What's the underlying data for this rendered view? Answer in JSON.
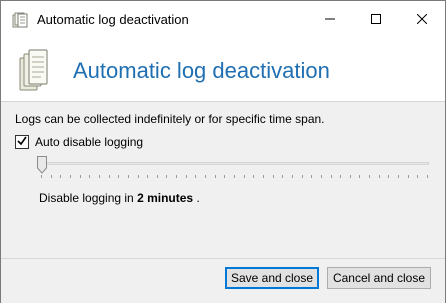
{
  "window": {
    "title": "Automatic log deactivation",
    "icon": "log-files-icon",
    "controls": {
      "minimize": "minimize-icon",
      "maximize": "maximize-icon",
      "close": "close-icon"
    }
  },
  "header": {
    "title": "Automatic log deactivation",
    "icon": "log-files-icon"
  },
  "main": {
    "description": "Logs can be collected indefinitely or for specific time span.",
    "auto_disable": {
      "label": "Auto disable logging",
      "checked": true
    },
    "slider": {
      "value_fraction": 0.0
    },
    "status": {
      "prefix": "Disable logging in",
      "value": "2 minutes",
      "suffix": "."
    }
  },
  "footer": {
    "save_label": "Save and close",
    "cancel_label": "Cancel and close"
  },
  "colors": {
    "header_title": "#1f6fb2",
    "default_button_border": "#0078d7"
  }
}
